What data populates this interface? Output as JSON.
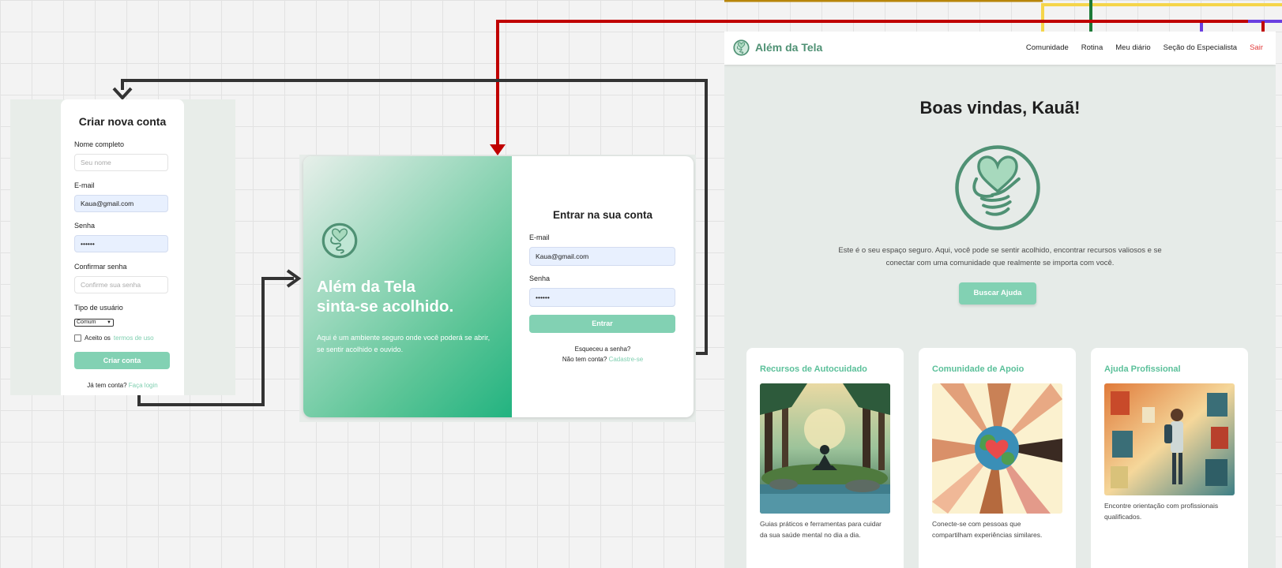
{
  "signup": {
    "title": "Criar nova conta",
    "name_label": "Nome completo",
    "name_placeholder": "Seu nome",
    "email_label": "E-mail",
    "email_value": "Kaua@gmail.com",
    "password_label": "Senha",
    "password_value": "••••••",
    "confirm_label": "Confirmar senha",
    "confirm_placeholder": "Confirme sua senha",
    "user_type_label": "Tipo de usuário",
    "user_type_value": "Comum",
    "terms_prefix": "Aceito os",
    "terms_link": "termos de uso",
    "submit_label": "Criar conta",
    "footer_prefix": "Já tem conta?",
    "footer_link": "Faça login"
  },
  "login": {
    "hero_title_line1": "Além da Tela",
    "hero_title_line2": "sinta-se acolhido.",
    "hero_text": "Aqui é um ambiente seguro onde você poderá se abrir, se sentir acolhido e ouvido.",
    "form_title": "Entrar na sua conta",
    "email_label": "E-mail",
    "email_value": "Kaua@gmail.com",
    "password_label": "Senha",
    "password_value": "••••••",
    "submit_label": "Entrar",
    "forgot_label": "Esqueceu a senha?",
    "signup_prefix": "Não tem conta?",
    "signup_link": "Cadastre-se"
  },
  "home": {
    "brand": "Além da Tela",
    "nav": [
      "Comunidade",
      "Rotina",
      "Meu diário",
      "Seção do Especialista",
      "Sair"
    ],
    "welcome": "Boas vindas, Kauã!",
    "intro": "Este é o seu espaço seguro. Aqui, você pode se sentir acolhido, encontrar recursos valiosos e se conectar com uma comunidade que realmente se importa com você.",
    "cta_label": "Buscar Ajuda",
    "cards": [
      {
        "title": "Recursos de Autocuidado",
        "description": "Guias práticos e ferramentas para cuidar da sua saúde mental no dia a dia."
      },
      {
        "title": "Comunidade de Apoio",
        "description": "Conecte-se com pessoas que compartilham experiências similares."
      },
      {
        "title": "Ajuda Profissional",
        "description": "Encontre orientação com profissionais qualificados."
      }
    ]
  },
  "colors": {
    "brand_green": "#4f9174",
    "accent_mint": "#82d1b3",
    "card_title": "#5bc09a",
    "exit_red": "#e23b3b",
    "flow_dark": "#333333",
    "flow_red": "#c00000",
    "flow_yellow": "#f5d54a",
    "flow_green": "#1d7a38",
    "flow_purple": "#6a3fe0"
  },
  "icons": {
    "logo": "heart-hands-icon"
  }
}
